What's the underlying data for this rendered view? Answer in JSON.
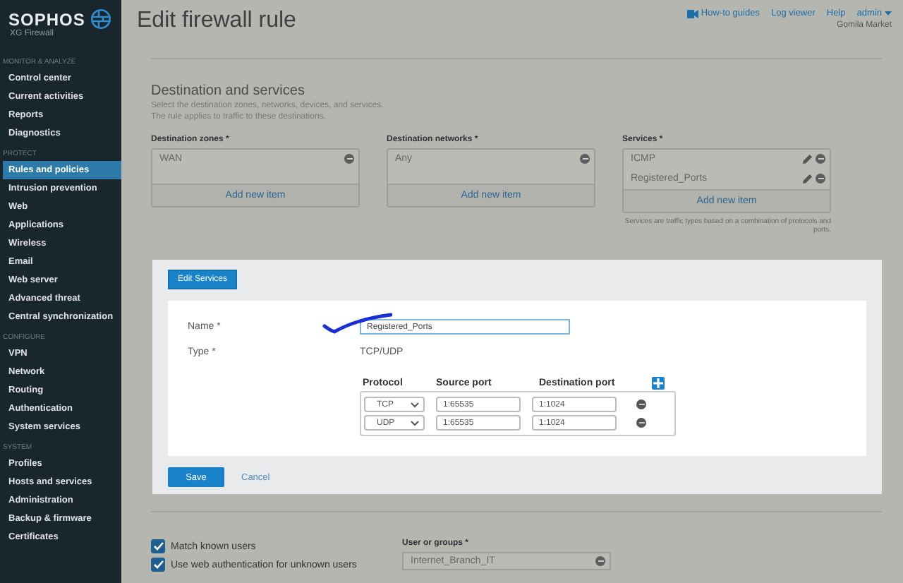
{
  "sidebar": {
    "brand": "SOPHOS",
    "product": "XG Firewall",
    "sections": [
      {
        "heading": "MONITOR & ANALYZE",
        "items": [
          {
            "label": "Control center",
            "selected": false
          },
          {
            "label": "Current activities",
            "selected": false
          },
          {
            "label": "Reports",
            "selected": false
          },
          {
            "label": "Diagnostics",
            "selected": false
          }
        ]
      },
      {
        "heading": "PROTECT",
        "items": [
          {
            "label": "Rules and policies",
            "selected": true
          },
          {
            "label": "Intrusion prevention",
            "selected": false
          },
          {
            "label": "Web",
            "selected": false
          },
          {
            "label": "Applications",
            "selected": false
          },
          {
            "label": "Wireless",
            "selected": false
          },
          {
            "label": "Email",
            "selected": false
          },
          {
            "label": "Web server",
            "selected": false
          },
          {
            "label": "Advanced threat",
            "selected": false
          },
          {
            "label": "Central synchronization",
            "selected": false
          }
        ]
      },
      {
        "heading": "CONFIGURE",
        "items": [
          {
            "label": "VPN",
            "selected": false
          },
          {
            "label": "Network",
            "selected": false
          },
          {
            "label": "Routing",
            "selected": false
          },
          {
            "label": "Authentication",
            "selected": false
          },
          {
            "label": "System services",
            "selected": false
          }
        ]
      },
      {
        "heading": "SYSTEM",
        "items": [
          {
            "label": "Profiles",
            "selected": false
          },
          {
            "label": "Hosts and services",
            "selected": false
          },
          {
            "label": "Administration",
            "selected": false
          },
          {
            "label": "Backup & firmware",
            "selected": false
          },
          {
            "label": "Certificates",
            "selected": false
          }
        ]
      }
    ]
  },
  "header": {
    "title": "Edit firewall rule",
    "links": [
      {
        "label": "How-to guides",
        "kind": "video"
      },
      {
        "label": "Log viewer",
        "kind": "plain"
      },
      {
        "label": "Help",
        "kind": "plain"
      },
      {
        "label": "admin",
        "kind": "menu"
      }
    ],
    "account": "Gomila Market"
  },
  "section": {
    "title": "Destination and services",
    "description": [
      "Select the destination zones, networks, devices, and services.",
      "The rule applies to traffic to these destinations."
    ],
    "columns": [
      {
        "label": "Destination zones *",
        "items": [
          {
            "text": "WAN",
            "editable": false
          }
        ],
        "add": "Add new item"
      },
      {
        "label": "Destination networks *",
        "items": [
          {
            "text": "Any",
            "editable": false
          }
        ],
        "add": "Add new item"
      },
      {
        "label": "Services *",
        "items": [
          {
            "text": "ICMP",
            "editable": true
          },
          {
            "text": "Registered_Ports",
            "editable": true
          }
        ],
        "add": "Add new item",
        "note": "Services are traffic types based on a combination of protocols and ports."
      }
    ]
  },
  "dialog": {
    "tab": "Edit Services",
    "name_label": "Name *",
    "name_value": "Registered_Ports",
    "type_label": "Type *",
    "type_value": "TCP/UDP",
    "columns": [
      "Protocol",
      "Source port",
      "Destination port"
    ],
    "rows": [
      {
        "protocol": "TCP",
        "source": "1:65535",
        "destination": "1:1024"
      },
      {
        "protocol": "UDP",
        "source": "1:65535",
        "destination": "1:1024"
      }
    ],
    "save": "Save",
    "cancel": "Cancel"
  },
  "users": {
    "options": [
      {
        "label": "Match known users",
        "checked": true
      },
      {
        "label": "Use web authentication for unknown users",
        "checked": true
      }
    ],
    "group_label": "User or groups *",
    "group_value": "Internet_Branch_IT"
  }
}
